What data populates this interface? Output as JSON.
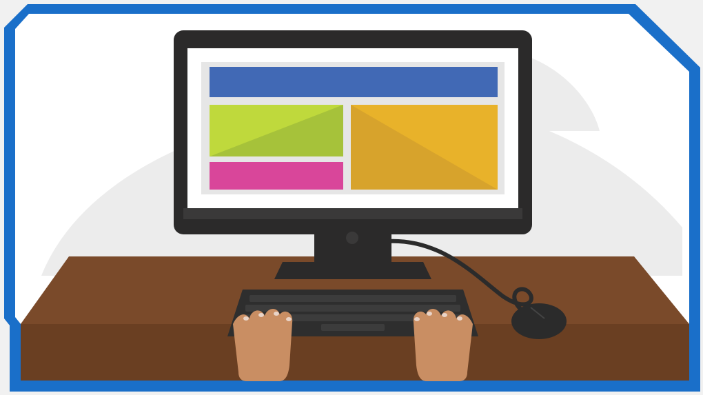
{
  "colors": {
    "page_background": "#f1f1f1",
    "frame": "#1a6fc9",
    "panel": "#ffffff",
    "backdrop_hills": "#ececec",
    "desk_top": "#7a4a2a",
    "desk_front": "#6a3f22",
    "monitor_body": "#2b2a2a",
    "monitor_bezel": "#3a3939",
    "screen": "#ffffff",
    "screen_bg": "#e6e6e6",
    "header_block": "#4169b5",
    "green_block": "#a6c23a",
    "pink_block": "#d9469a",
    "yellow_block": "#e8b22a",
    "keyboard": "#2e2e2e",
    "mouse": "#2b2b2b",
    "skin": "#c98e63",
    "nails": "#e9d4c8"
  },
  "icons": {
    "frame": "octagon-frame-icon",
    "monitor": "monitor-icon",
    "keyboard": "keyboard-icon",
    "mouse": "mouse-icon",
    "hands": "hands-icon"
  }
}
